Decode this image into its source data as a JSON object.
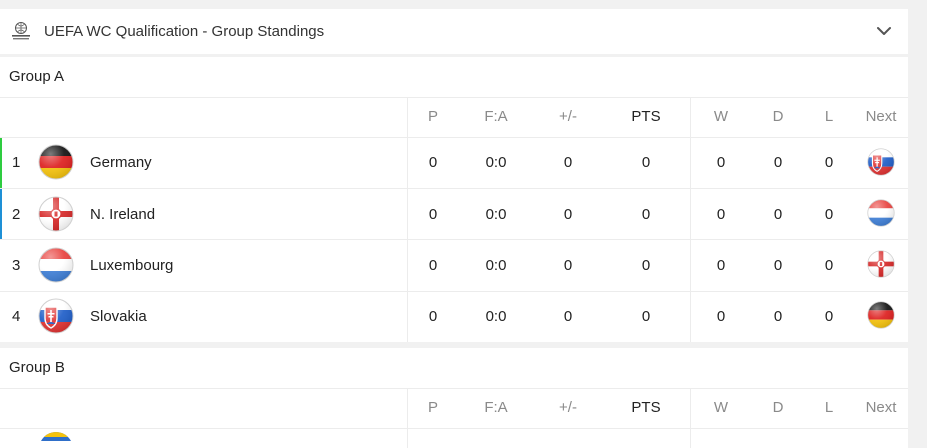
{
  "header": {
    "title": "UEFA WC Qualification - Group Standings",
    "logo_icon": "uefa-wc-qualifiers-logo-icon",
    "toggle_icon": "chevron-down-icon"
  },
  "columns": {
    "p": "P",
    "fa": "F:A",
    "diff": "+/-",
    "pts": "PTS",
    "w": "W",
    "d": "D",
    "l": "L",
    "next": "Next"
  },
  "groups": [
    {
      "name": "Group A",
      "rows": [
        {
          "rank": "1",
          "team": "Germany",
          "flag": "germany-flag-icon",
          "p": "0",
          "fa": "0:0",
          "diff": "0",
          "pts": "0",
          "w": "0",
          "d": "0",
          "l": "0",
          "next_flag": "slovakia-flag-icon",
          "accent": "#2ecc40"
        },
        {
          "rank": "2",
          "team": "N. Ireland",
          "flag": "northern-ireland-flag-icon",
          "p": "0",
          "fa": "0:0",
          "diff": "0",
          "pts": "0",
          "w": "0",
          "d": "0",
          "l": "0",
          "next_flag": "luxembourg-flag-icon",
          "accent": "#1e90d6"
        },
        {
          "rank": "3",
          "team": "Luxembourg",
          "flag": "luxembourg-flag-icon",
          "p": "0",
          "fa": "0:0",
          "diff": "0",
          "pts": "0",
          "w": "0",
          "d": "0",
          "l": "0",
          "next_flag": "northern-ireland-flag-icon",
          "accent": ""
        },
        {
          "rank": "4",
          "team": "Slovakia",
          "flag": "slovakia-flag-icon",
          "p": "0",
          "fa": "0:0",
          "diff": "0",
          "pts": "0",
          "w": "0",
          "d": "0",
          "l": "0",
          "next_flag": "germany-flag-icon",
          "accent": ""
        }
      ]
    },
    {
      "name": "Group B",
      "rows": []
    }
  ],
  "colors": {
    "background": "#f1f1f1",
    "card": "#ffffff",
    "divider": "#ececec",
    "header_text": "#8a8a8a",
    "first_accent": "#2ecc40",
    "second_accent": "#1e90d6"
  }
}
